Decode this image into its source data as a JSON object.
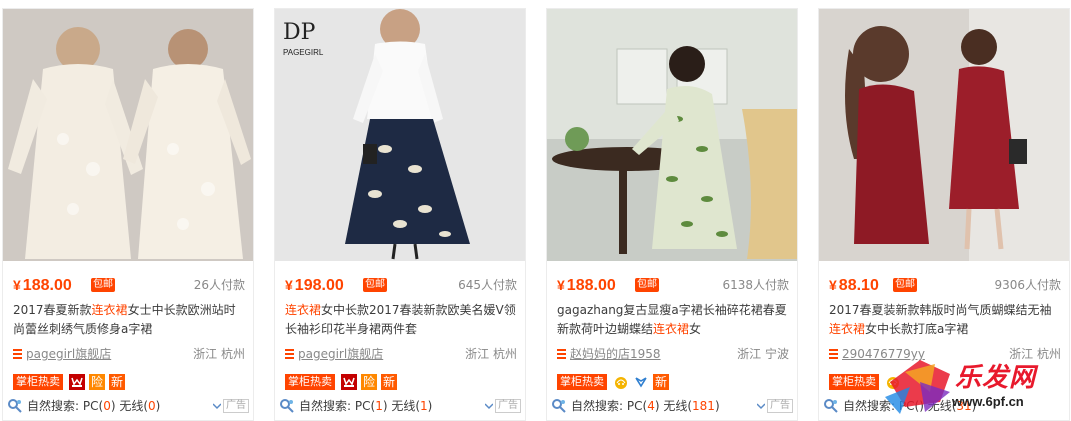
{
  "currency_symbol": "¥",
  "baoyou_label": "包邮",
  "hot_label": "掌柜热卖",
  "search_label": "自然搜索:",
  "pc_label": "PC",
  "wireless_label": "无线",
  "ad_label": "广告",
  "colors": {
    "accent": "#ff4400",
    "muted": "#888888",
    "text": "#3c3c3c"
  },
  "products": [
    {
      "price": "188.00",
      "paid_count": "26人付款",
      "title_before": "2017春夏新款",
      "title_highlight": "连衣裙",
      "title_after": "女士中长款欧洲站时尚蕾丝刺绣气质修身a字裙",
      "shop_name": "pagegirl旗舰店",
      "location": "浙江 杭州",
      "badges": [
        "tmall-icon",
        "insurance-icon",
        "new-icon"
      ],
      "badge_text": {
        "insurance": "险",
        "new": "新"
      },
      "pc_count": "0",
      "wireless_count": "0"
    },
    {
      "price": "198.00",
      "paid_count": "645人付款",
      "title_before": "",
      "title_highlight": "连衣裙",
      "title_after": "女中长款2017春装新款欧美名媛V领长袖衫印花半身裙两件套",
      "shop_name": "pagegirl旗舰店",
      "location": "浙江 杭州",
      "brand_logo_text": "PAGEGIRL",
      "badges": [
        "tmall-icon",
        "insurance-icon",
        "new-icon"
      ],
      "badge_text": {
        "insurance": "险",
        "new": "新"
      },
      "pc_count": "1",
      "wireless_count": "1"
    },
    {
      "price": "188.00",
      "paid_count": "6138人付款",
      "title_before": "gagazhang复古显瘦a字裙长袖碎花裙春夏新款荷叶边蝴蝶结",
      "title_highlight": "连衣裙",
      "title_after": "女",
      "shop_name": "赵妈妈的店1958",
      "location": "浙江 宁波",
      "badges": [
        "gold-medal-icon",
        "heart-icon",
        "new-icon"
      ],
      "badge_text": {
        "new": "新"
      },
      "pc_count": "4",
      "wireless_count": "181"
    },
    {
      "price": "88.10",
      "paid_count": "9306人付款",
      "title_before": "2017春夏装新款韩版时尚气质蝴蝶结无袖",
      "title_highlight": "连衣裙",
      "title_after": "女中长款打底a字裙",
      "shop_name": "290476779yy",
      "location": "浙江 杭州",
      "badges": [
        "gold-medal-icon"
      ],
      "pc_count": "",
      "wireless_count": "31"
    }
  ],
  "watermark": {
    "text": "乐发网",
    "url": "www.6pf.cn"
  }
}
